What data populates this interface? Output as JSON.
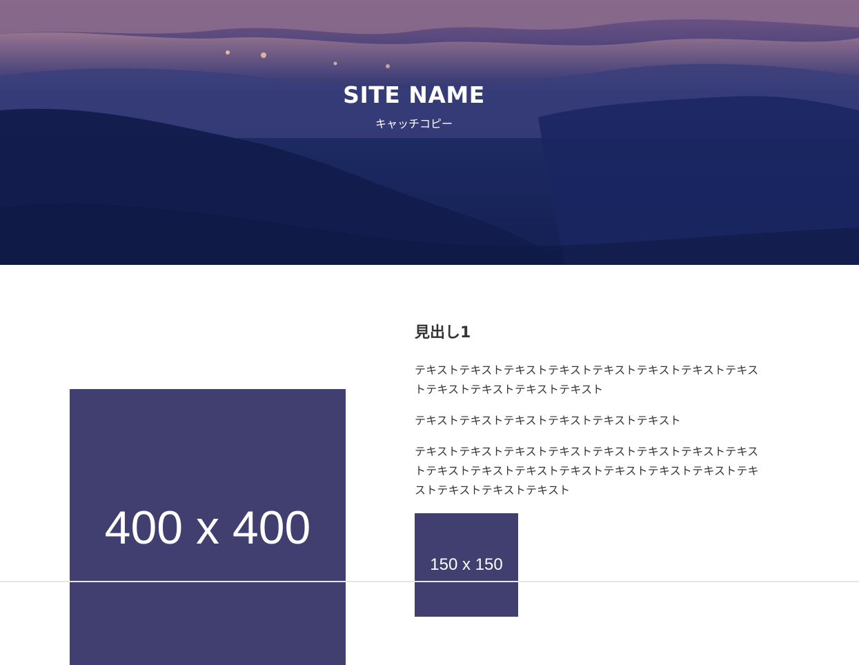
{
  "hero": {
    "site_name": "SITE NAME",
    "catch_copy": "キャッチコピー"
  },
  "main": {
    "heading": "見出し1",
    "paragraphs": [
      "テキストテキストテキストテキストテキストテキストテキストテキストテキストテキストテキストテキスト",
      "テキストテキストテキストテキストテキストテキスト",
      "テキストテキストテキストテキストテキストテキストテキストテキストテキストテキストテキストテキストテキストテキストテキストテキストテキストテキストテキスト"
    ],
    "image_large_label": "400 x 400",
    "image_small_label": "150 x 150"
  },
  "colors": {
    "placeholder_bg": "#403f6f",
    "text": "#333333",
    "hero_dark": "#141f52"
  }
}
